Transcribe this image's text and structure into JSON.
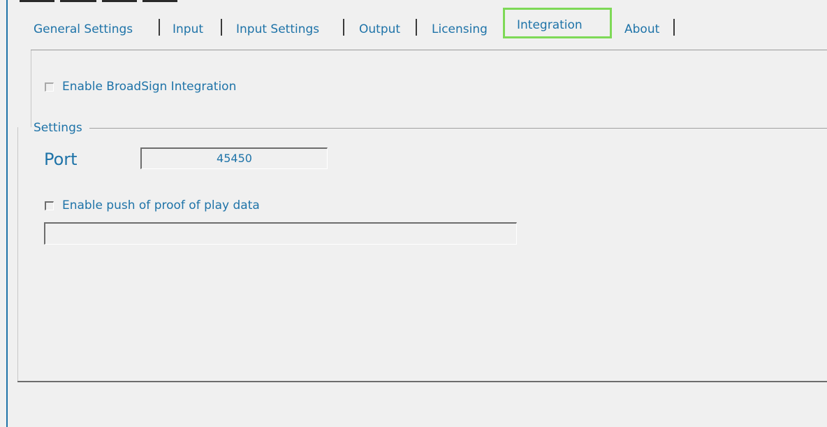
{
  "tabs": [
    {
      "label": "General Settings"
    },
    {
      "label": "Input"
    },
    {
      "label": "Input Settings"
    },
    {
      "label": "Output"
    },
    {
      "label": "Licensing"
    },
    {
      "label": "Integration",
      "active": true
    },
    {
      "label": "About"
    }
  ],
  "integration": {
    "enable_broadsign_label": "Enable BroadSign Integration",
    "enable_broadsign_checked": false,
    "settings_group_label": "Settings",
    "port_label": "Port",
    "port_value": "45450",
    "enable_pop_label": "Enable push of proof of play data",
    "enable_pop_checked": false,
    "pop_url_value": ""
  },
  "colors": {
    "text_accent": "#1e73a8",
    "active_tab_border": "#7ed957",
    "background": "#f0f0f0"
  }
}
